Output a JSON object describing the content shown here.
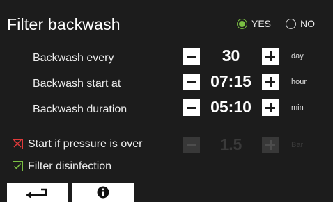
{
  "title": "Filter backwash",
  "enable": {
    "yes_label": "YES",
    "no_label": "NO",
    "selected": "YES",
    "accent_color": "#7bc043"
  },
  "settings": [
    {
      "label": "Backwash every",
      "value": "30",
      "unit": "day",
      "enabled": true
    },
    {
      "label": "Backwash start at",
      "value": "07:15",
      "unit": "hour",
      "enabled": true
    },
    {
      "label": "Backwash duration",
      "value": "05:10",
      "unit": "min",
      "enabled": true
    }
  ],
  "pressure": {
    "label": "Start if pressure is over",
    "checked": false,
    "check_color": "#e03a3a",
    "value": "1.5",
    "unit": "Bar",
    "enabled": false
  },
  "disinfection": {
    "label": "Filter disinfection",
    "checked": true,
    "check_color": "#7bc043"
  },
  "footer": {
    "back_icon": "return-arrow-icon",
    "info_icon": "info-icon"
  }
}
